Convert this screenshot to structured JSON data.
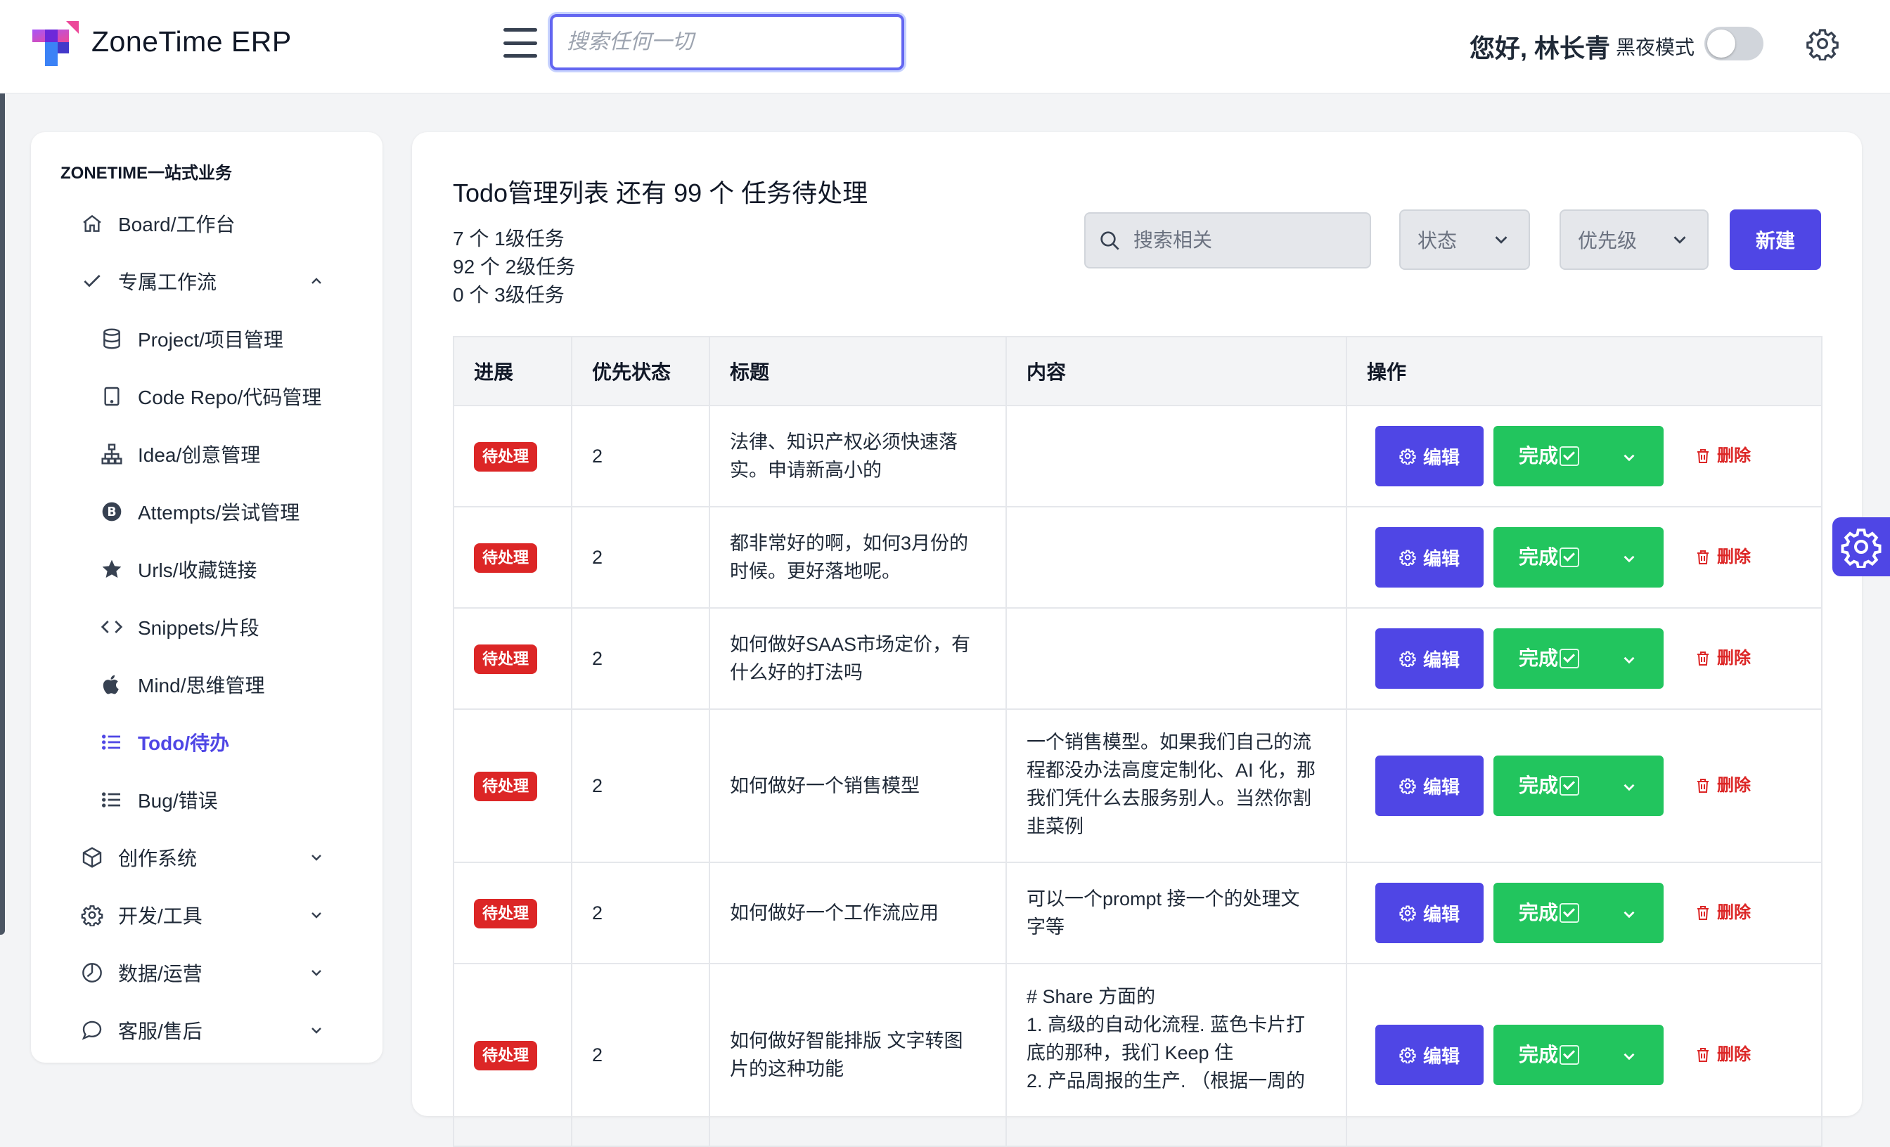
{
  "header": {
    "brand": "ZoneTime ERP",
    "search_placeholder": "搜索任何一切",
    "greeting": "您好, 林长青",
    "dark_mode_label": "黑夜模式"
  },
  "sidebar": {
    "section_title": "ZONETIME一站式业务",
    "items": [
      {
        "label": "Board/工作台",
        "icon": "home-icon"
      },
      {
        "label": "专属工作流",
        "icon": "check-icon",
        "expanded": true
      },
      {
        "label": "Project/项目管理",
        "icon": "database-icon"
      },
      {
        "label": "Code Repo/代码管理",
        "icon": "tablet-icon"
      },
      {
        "label": "Idea/创意管理",
        "icon": "sitemap-icon"
      },
      {
        "label": "Attempts/尝试管理",
        "icon": "bitcoin-icon"
      },
      {
        "label": "Urls/收藏链接",
        "icon": "star-icon"
      },
      {
        "label": "Snippets/片段",
        "icon": "code-icon"
      },
      {
        "label": "Mind/思维管理",
        "icon": "apple-icon"
      },
      {
        "label": "Todo/待办",
        "icon": "list-icon",
        "active": true
      },
      {
        "label": "Bug/错误",
        "icon": "list-icon"
      },
      {
        "label": "创作系统",
        "icon": "cube-icon"
      },
      {
        "label": "开发/工具",
        "icon": "gear-icon"
      },
      {
        "label": "数据/运营",
        "icon": "clock-icon"
      },
      {
        "label": "客服/售后",
        "icon": "chat-icon"
      }
    ]
  },
  "main": {
    "title": "Todo管理列表 还有 99 个 任务待处理",
    "stats": [
      "7 个 1级任务",
      "92 个 2级任务",
      "0 个 3级任务"
    ],
    "search_placeholder": "搜索相关",
    "status_select": "状态",
    "priority_select": "优先级",
    "new_button": "新建",
    "columns": [
      "进展",
      "优先状态",
      "标题",
      "内容",
      "操作"
    ],
    "edit_label": "编辑",
    "done_label": "完成",
    "delete_label": "删除",
    "rows": [
      {
        "status": "待处理",
        "priority": "2",
        "title": [
          "法律、知识产权必须快速落",
          "实。申请新高小的"
        ],
        "content": []
      },
      {
        "status": "待处理",
        "priority": "2",
        "title": [
          "都非常好的啊，如何3月份的",
          "时候。更好落地呢。"
        ],
        "content": []
      },
      {
        "status": "待处理",
        "priority": "2",
        "title": [
          "如何做好SAAS市场定价，有",
          "什么好的打法吗"
        ],
        "content": []
      },
      {
        "status": "待处理",
        "priority": "2",
        "title": [
          "如何做好一个销售模型"
        ],
        "content": [
          "一个销售模型。如果我们自己的流",
          "程都没办法高度定制化、AI 化，那",
          "我们凭什么去服务别人。当然你割",
          "韭菜例"
        ]
      },
      {
        "status": "待处理",
        "priority": "2",
        "title": [
          "如何做好一个工作流应用"
        ],
        "content": [
          "可以一个prompt 接一个的处理文",
          "字等"
        ]
      },
      {
        "status": "待处理",
        "priority": "2",
        "title": [
          "如何做好智能排版 文字转图",
          "片的这种功能"
        ],
        "content": [
          "# Share 方面的",
          "1. 高级的自动化流程. 蓝色卡片打",
          "底的那种，我们 Keep 住",
          "2. 产品周报的生产. （根据一周的"
        ]
      }
    ]
  },
  "colors": {
    "primary": "#4f46e5",
    "success": "#22c55e",
    "danger": "#dc2626"
  }
}
